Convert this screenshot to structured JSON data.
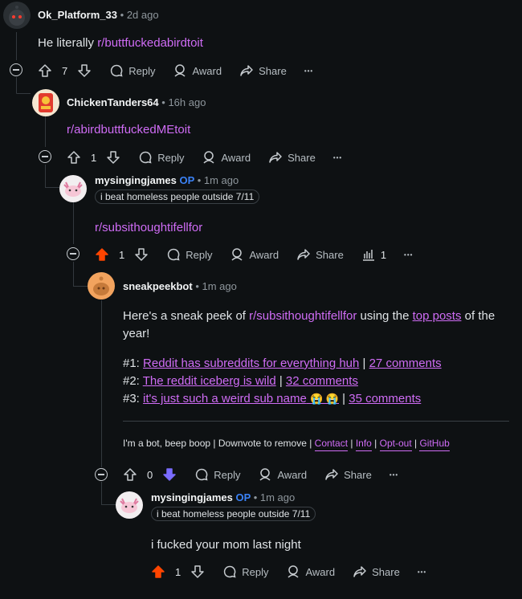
{
  "comments": [
    {
      "user": "Ok_Platform_33",
      "time": "2d ago",
      "body_link": "r/buttfuckedabirdtoit",
      "prefix": "He literally ",
      "votes": "7",
      "reply": "Reply",
      "award": "Award",
      "share": "Share"
    },
    {
      "user": "ChickenTanders64",
      "time": "16h ago",
      "body_link": "r/abirdbuttfuckedMEtoit",
      "votes": "1",
      "reply": "Reply",
      "award": "Award",
      "share": "Share"
    },
    {
      "user": "mysingingjames",
      "op": "OP",
      "time": "1m ago",
      "flair": "i beat homeless people outside 7/11",
      "body_link": "r/subsithoughtifellfor",
      "votes": "1",
      "reply": "Reply",
      "award": "Award",
      "share": "Share",
      "insights": "1"
    },
    {
      "user": "sneakpeekbot",
      "time": "1m ago",
      "intro_1": "Here's a sneak peek of ",
      "intro_link": "r/subsithoughtifellfor",
      "intro_2": " using the ",
      "intro_top": "top posts",
      "intro_3": " of the",
      "intro_4": "year!",
      "posts": [
        {
          "num": "#1: ",
          "title": "Reddit has subreddits for everything huh",
          "sep": " | ",
          "comments": "27 comments"
        },
        {
          "num": "#2: ",
          "title": "The reddit iceberg is wild",
          "sep": " | ",
          "comments": "32 comments"
        },
        {
          "num": "#3: ",
          "title": "it's just such a weird sub name",
          "emoji": "😭 😭",
          "sep": " | ",
          "comments": "35 comments"
        }
      ],
      "footer_text": "I'm a bot, beep boop | Downvote to remove | ",
      "footer_links": [
        "Contact",
        "Info",
        "Opt-out",
        "GitHub"
      ],
      "votes": "0",
      "reply": "Reply",
      "award": "Award",
      "share": "Share"
    },
    {
      "user": "mysingingjames",
      "op": "OP",
      "time": "1m ago",
      "flair": "i beat homeless people outside 7/11",
      "body": "i fucked your mom last night",
      "votes": "1",
      "reply": "Reply",
      "award": "Award",
      "share": "Share"
    }
  ],
  "meta_sep": "•",
  "more_label": "•••",
  "colors": {
    "upvoted": "#ff4500",
    "downvoted": "#7a6cff",
    "link": "#cf6cf5",
    "op": "#3b82f6"
  },
  "icons": [
    "upvote-icon",
    "downvote-icon",
    "reply-bubble-icon",
    "award-icon",
    "share-icon",
    "insights-icon",
    "more-icon",
    "collapse-icon"
  ]
}
